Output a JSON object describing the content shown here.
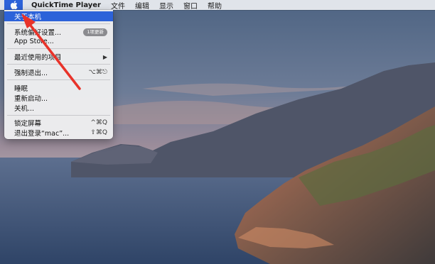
{
  "menubar": {
    "app_name": "QuickTime Player",
    "items": [
      "文件",
      "编辑",
      "显示",
      "窗口",
      "帮助"
    ]
  },
  "apple_menu": {
    "about": "关于本机",
    "system_prefs": "系统偏好设置...",
    "system_prefs_badge": "1项更新",
    "app_store": "App Store...",
    "recent_items": "最近使用的项目",
    "force_quit": "强制退出...",
    "force_quit_shortcut": "⌥⌘⎋",
    "sleep": "睡眠",
    "restart": "重新启动...",
    "shutdown": "关机...",
    "lock_screen": "锁定屏幕",
    "lock_screen_shortcut": "^⌘Q",
    "log_out": "退出登录“mac”...",
    "log_out_shortcut": "⇧⌘Q"
  },
  "colors": {
    "menu_highlight": "#2c62d9",
    "annotation_arrow": "#e8332a"
  }
}
